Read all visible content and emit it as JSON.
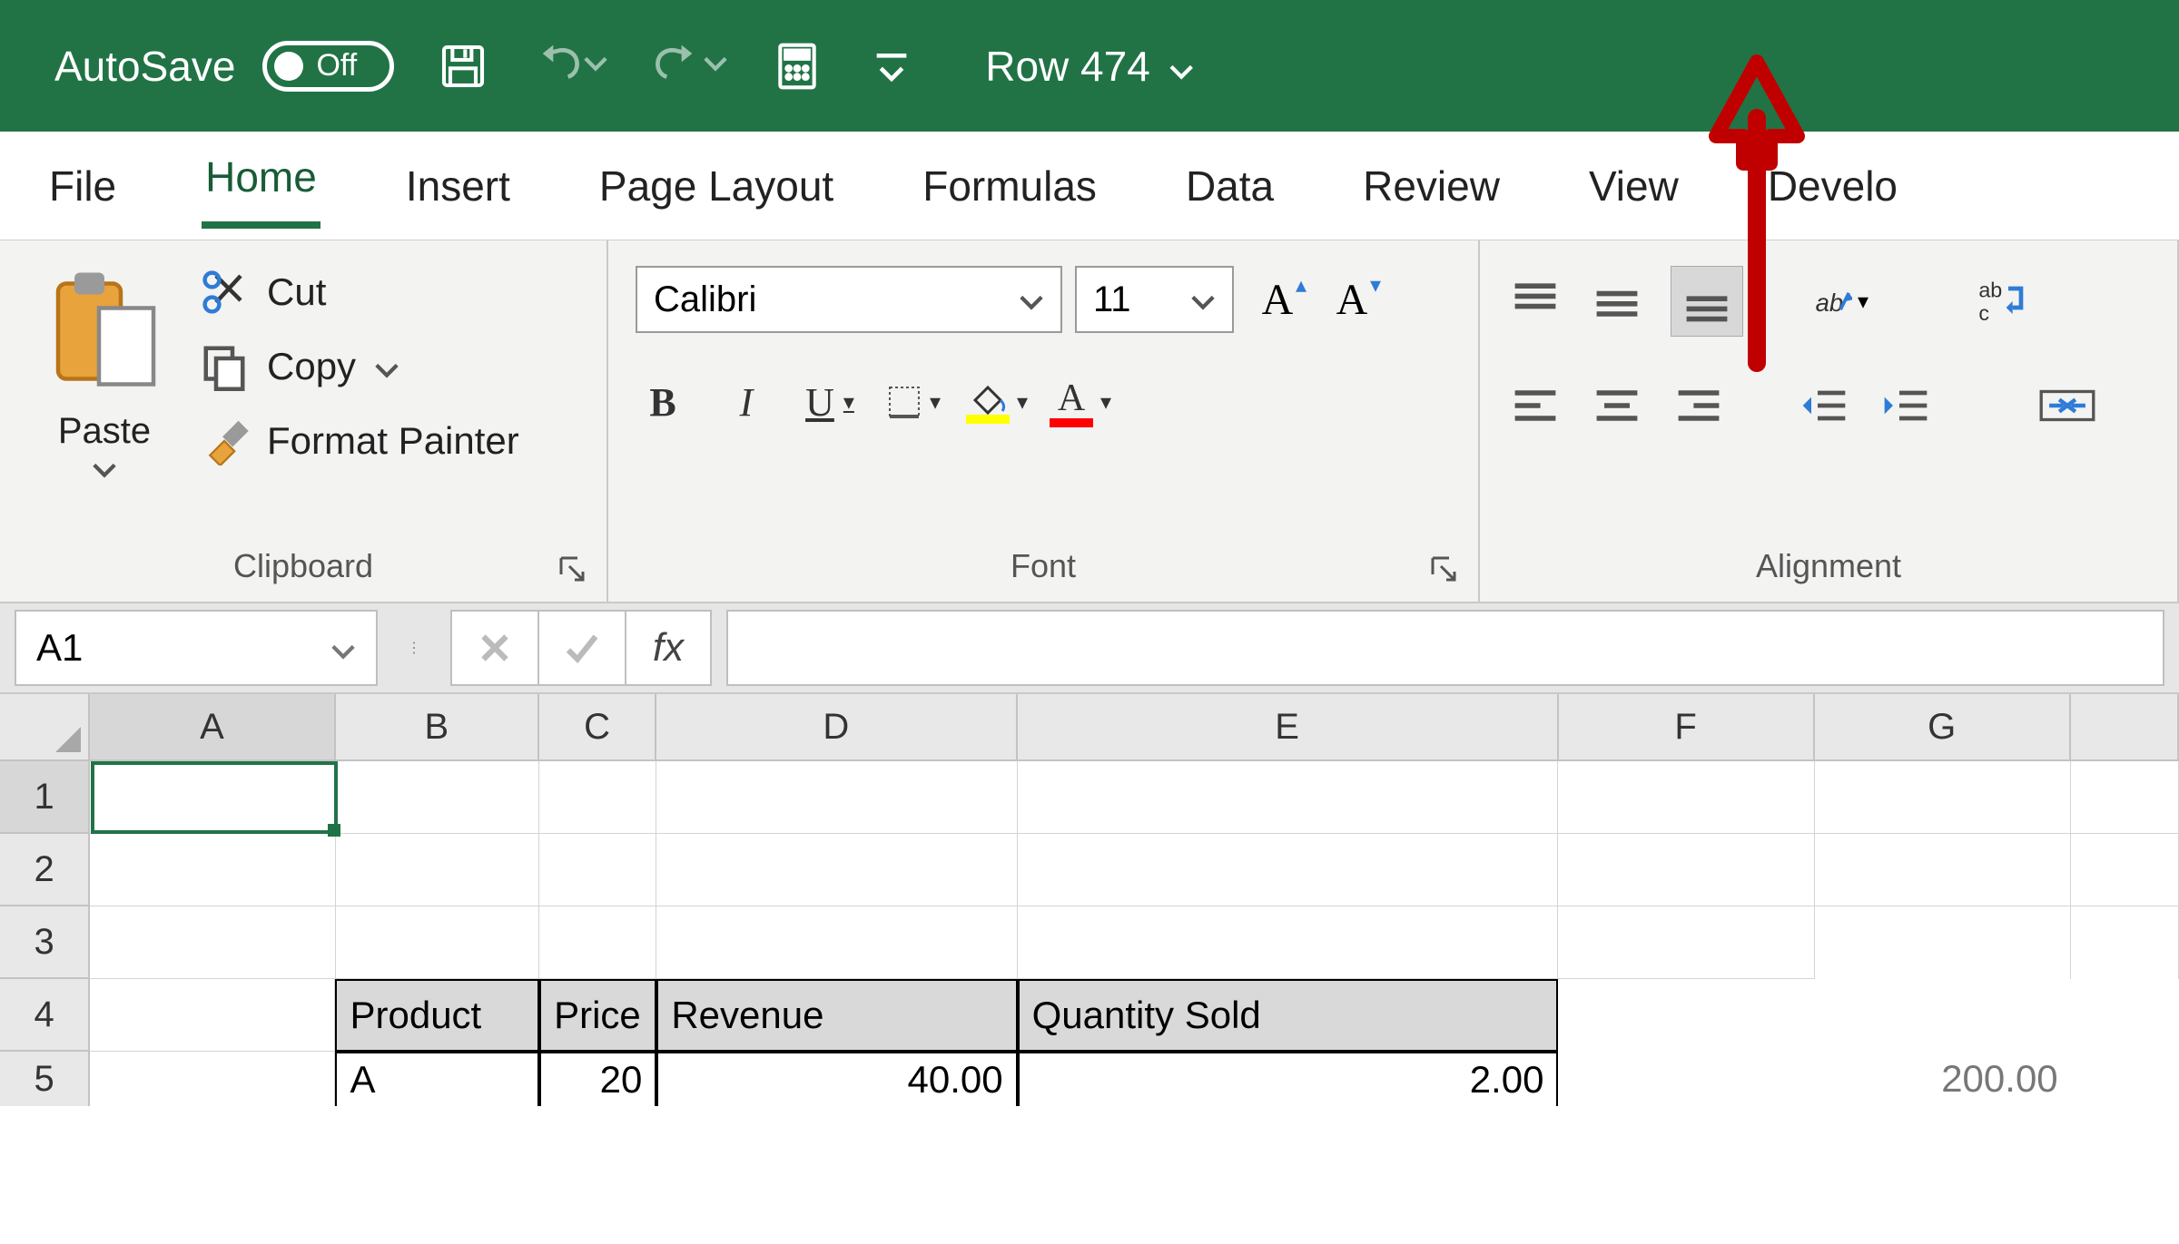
{
  "titlebar": {
    "autosave_label": "AutoSave",
    "autosave_state": "Off",
    "document_title": "Row 474"
  },
  "tabs": {
    "file": "File",
    "home": "Home",
    "insert": "Insert",
    "pagelayout": "Page Layout",
    "formulas": "Formulas",
    "data": "Data",
    "review": "Review",
    "view": "View",
    "developer": "Develo"
  },
  "ribbon": {
    "clipboard": {
      "paste": "Paste",
      "cut": "Cut",
      "copy": "Copy",
      "format_painter": "Format Painter",
      "group_label": "Clipboard"
    },
    "font": {
      "name": "Calibri",
      "size": "11",
      "group_label": "Font",
      "wrap_glyph": "ab\nc"
    },
    "alignment": {
      "group_label": "Alignment"
    }
  },
  "formula_bar": {
    "name_box": "A1",
    "fx": "fx",
    "formula": ""
  },
  "grid": {
    "columns": [
      "A",
      "B",
      "C",
      "D",
      "E",
      "F",
      "G"
    ],
    "row_numbers": [
      "1",
      "2",
      "3",
      "4",
      "5"
    ],
    "header_row": {
      "B": "Product",
      "C": "Price",
      "D": "Revenue",
      "E": "Quantity Sold"
    },
    "data_row": {
      "B": "A",
      "C": "20",
      "D": "40.00",
      "E": "2.00"
    },
    "g5": "200.00"
  }
}
